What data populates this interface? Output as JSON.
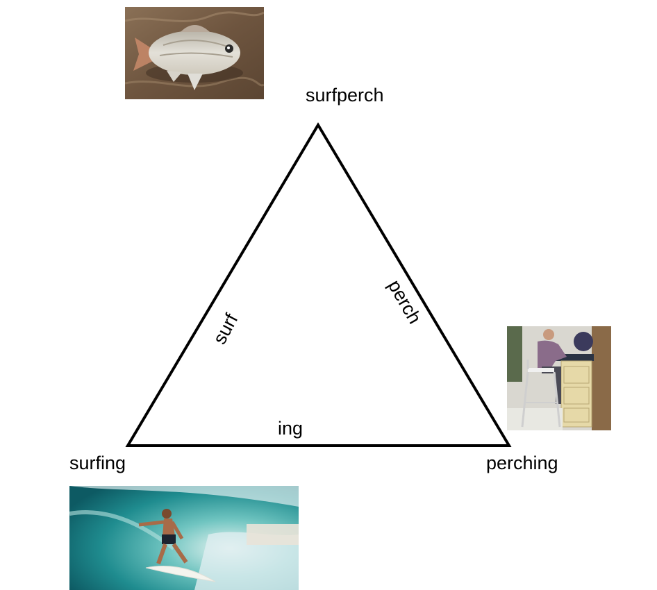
{
  "nodes": {
    "top": {
      "label": "surfperch",
      "photo_icon": "fish-photo"
    },
    "left": {
      "label": "surfing",
      "photo_icon": "surfer-photo"
    },
    "right": {
      "label": "perching",
      "photo_icon": "perching-stool-photo"
    }
  },
  "edges": {
    "left": {
      "label": "surf"
    },
    "right": {
      "label": "perch"
    },
    "bottom": {
      "label": "ing"
    }
  },
  "colors": {
    "line": "#000000",
    "sand": "#7a6048",
    "fish": "#c9c7bf",
    "ocean": "#1f8c8f",
    "wave_foam": "#dfeef0",
    "kitchen_cabinet": "#e6d9a8",
    "wall": "#8a6a48"
  }
}
